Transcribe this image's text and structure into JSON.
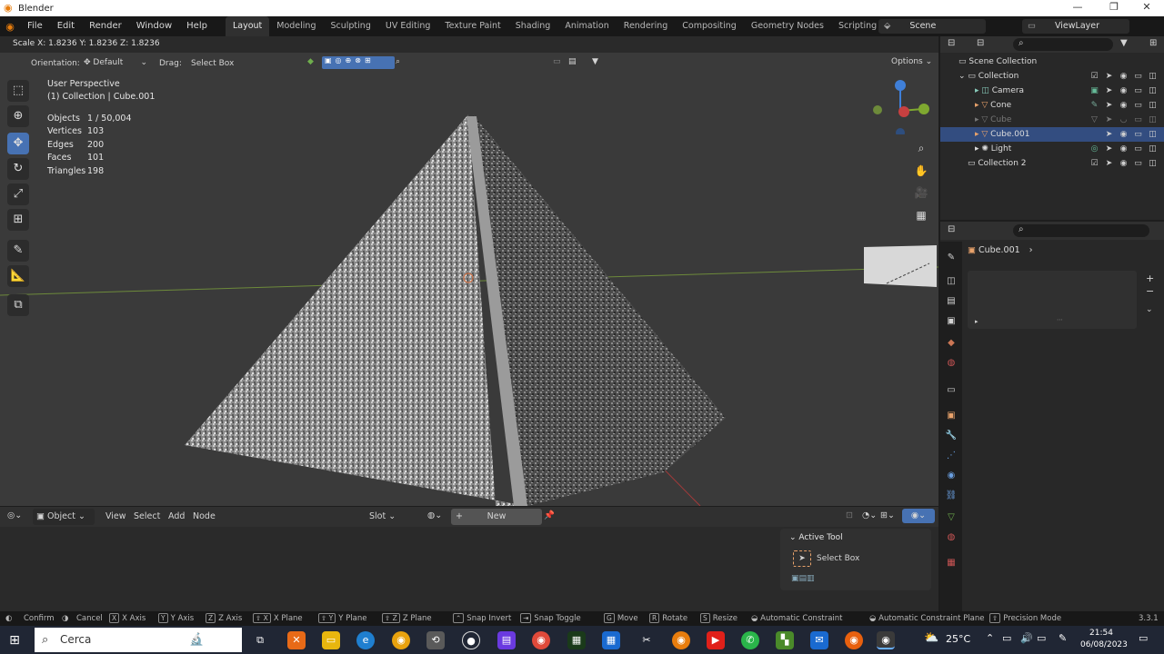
{
  "window": {
    "title": "Blender",
    "controls": [
      "—",
      "❐",
      "✕"
    ]
  },
  "menubar": {
    "menus": [
      "File",
      "Edit",
      "Render",
      "Window",
      "Help"
    ],
    "workspaces": [
      "Layout",
      "Modeling",
      "Sculpting",
      "UV Editing",
      "Texture Paint",
      "Shading",
      "Animation",
      "Rendering",
      "Compositing",
      "Geometry Nodes",
      "Scripting"
    ],
    "add_tab": "+",
    "scene": "Scene",
    "view_layer": "ViewLayer"
  },
  "viewport": {
    "operator_text": "Scale X: 1.8236   Y: 1.8236   Z: 1.8236",
    "orientation_label": "Orientation:",
    "orientation_value": "Default",
    "drag_label": "Drag:",
    "drag_value": "Select Box",
    "options": "Options",
    "view_name": "User Perspective",
    "collection_info": "(1) Collection | Cube.001",
    "stats": [
      {
        "label": "Objects",
        "value": "1 / 50,004"
      },
      {
        "label": "Vertices",
        "value": "103"
      },
      {
        "label": "Edges",
        "value": "200"
      },
      {
        "label": "Faces",
        "value": "101"
      },
      {
        "label": "Triangles",
        "value": "198"
      }
    ]
  },
  "outliner": {
    "root": "Scene Collection",
    "items": [
      {
        "name": "Collection",
        "indent": 1
      },
      {
        "name": "Camera",
        "indent": 2
      },
      {
        "name": "Cone",
        "indent": 2
      },
      {
        "name": "Cube",
        "indent": 2
      },
      {
        "name": "Cube.001",
        "indent": 2,
        "selected": true
      },
      {
        "name": "Light",
        "indent": 2
      },
      {
        "name": "Collection 2",
        "indent": 1
      }
    ]
  },
  "properties": {
    "object_name": "Cube.001"
  },
  "shader_editor": {
    "mode": "Object",
    "menus": [
      "View",
      "Select",
      "Add",
      "Node"
    ],
    "slot": "Slot",
    "new_button": "New",
    "active_tool_title": "Active Tool",
    "active_tool_name": "Select Box"
  },
  "statusbar": {
    "items": [
      {
        "key": "",
        "label": "Confirm"
      },
      {
        "key": "",
        "label": "Cancel"
      },
      {
        "key": "X",
        "label": "X Axis"
      },
      {
        "key": "Y",
        "label": "Y Axis"
      },
      {
        "key": "Z",
        "label": "Z Axis"
      },
      {
        "key": "⇧ X",
        "label": "X Plane"
      },
      {
        "key": "⇧ Y",
        "label": "Y Plane"
      },
      {
        "key": "⇧ Z",
        "label": "Z Plane"
      },
      {
        "key": "",
        "label": "Snap Invert"
      },
      {
        "key": "",
        "label": "Snap Toggle"
      },
      {
        "key": "G",
        "label": "Move"
      },
      {
        "key": "R",
        "label": "Rotate"
      },
      {
        "key": "S",
        "label": "Resize"
      },
      {
        "key": "",
        "label": "Automatic Constraint"
      },
      {
        "key": "",
        "label": "Automatic Constraint Plane"
      },
      {
        "key": "",
        "label": "Precision Mode"
      }
    ],
    "version": "3.3.1"
  },
  "taskbar": {
    "search_placeholder": "Cerca",
    "weather": "25°C",
    "time": "21:54",
    "date": "06/08/2023"
  },
  "colors": {
    "accent": "#4772b3",
    "selection": "#334d80",
    "x_axis": "#c74040",
    "y_axis": "#7fa830",
    "z_axis": "#3f7fd8"
  }
}
